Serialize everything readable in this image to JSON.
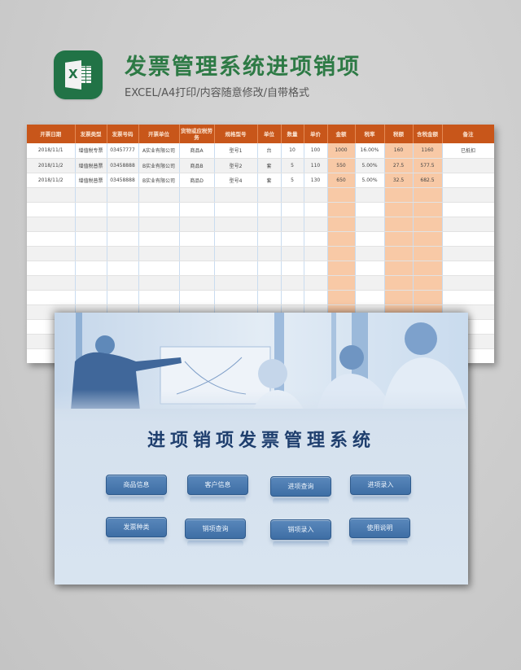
{
  "header": {
    "logo_icon": "excel-icon",
    "logo_letter": "X",
    "title": "发票管理系统进项销项",
    "subtitle": "EXCEL/A4打印/内容随意修改/自带格式"
  },
  "spreadsheet": {
    "colors": {
      "header_bg": "#c8561a",
      "highlight_col": "#f8c9a6",
      "grid_line": "#c9dcf0"
    },
    "columns": [
      {
        "label": "开票日期",
        "highlight": false
      },
      {
        "label": "发票类型",
        "highlight": false
      },
      {
        "label": "发票号码",
        "highlight": false
      },
      {
        "label": "开票单位",
        "highlight": false
      },
      {
        "label": "货物或应税劳务",
        "highlight": false
      },
      {
        "label": "规格型号",
        "highlight": false
      },
      {
        "label": "单位",
        "highlight": false
      },
      {
        "label": "数量",
        "highlight": false
      },
      {
        "label": "单价",
        "highlight": false
      },
      {
        "label": "金额",
        "highlight": true
      },
      {
        "label": "税率",
        "highlight": false
      },
      {
        "label": "税额",
        "highlight": true
      },
      {
        "label": "含税金额",
        "highlight": true
      },
      {
        "label": "备注",
        "highlight": false
      }
    ],
    "rows": [
      [
        "2018/11/1",
        "增值税专票",
        "03457777",
        "A实业有限公司",
        "商品A",
        "型号1",
        "台",
        "10",
        "100",
        "1000",
        "16.00%",
        "160",
        "1160",
        "已抵扣"
      ],
      [
        "2018/11/2",
        "增值税普票",
        "03458888",
        "B实业有限公司",
        "商品B",
        "型号2",
        "套",
        "5",
        "110",
        "550",
        "5.00%",
        "27.5",
        "577.5",
        ""
      ],
      [
        "2018/11/2",
        "增值税普票",
        "03458888",
        "B实业有限公司",
        "商品D",
        "型号4",
        "套",
        "5",
        "130",
        "650",
        "5.00%",
        "32.5",
        "682.5",
        ""
      ]
    ],
    "empty_row_count": 12
  },
  "menu": {
    "banner_image": "business-meeting-photo",
    "title": "进项销项发票管理系统",
    "buttons": [
      {
        "id": "goods-info",
        "label": "商品信息"
      },
      {
        "id": "customer-info",
        "label": "客户信息"
      },
      {
        "id": "input-query",
        "label": "进项查询"
      },
      {
        "id": "input-entry",
        "label": "进项录入"
      },
      {
        "id": "invoice-type",
        "label": "发票种类"
      },
      {
        "id": "output-query",
        "label": "销项查询"
      },
      {
        "id": "output-entry",
        "label": "销项录入"
      },
      {
        "id": "instructions",
        "label": "使用说明"
      }
    ]
  }
}
